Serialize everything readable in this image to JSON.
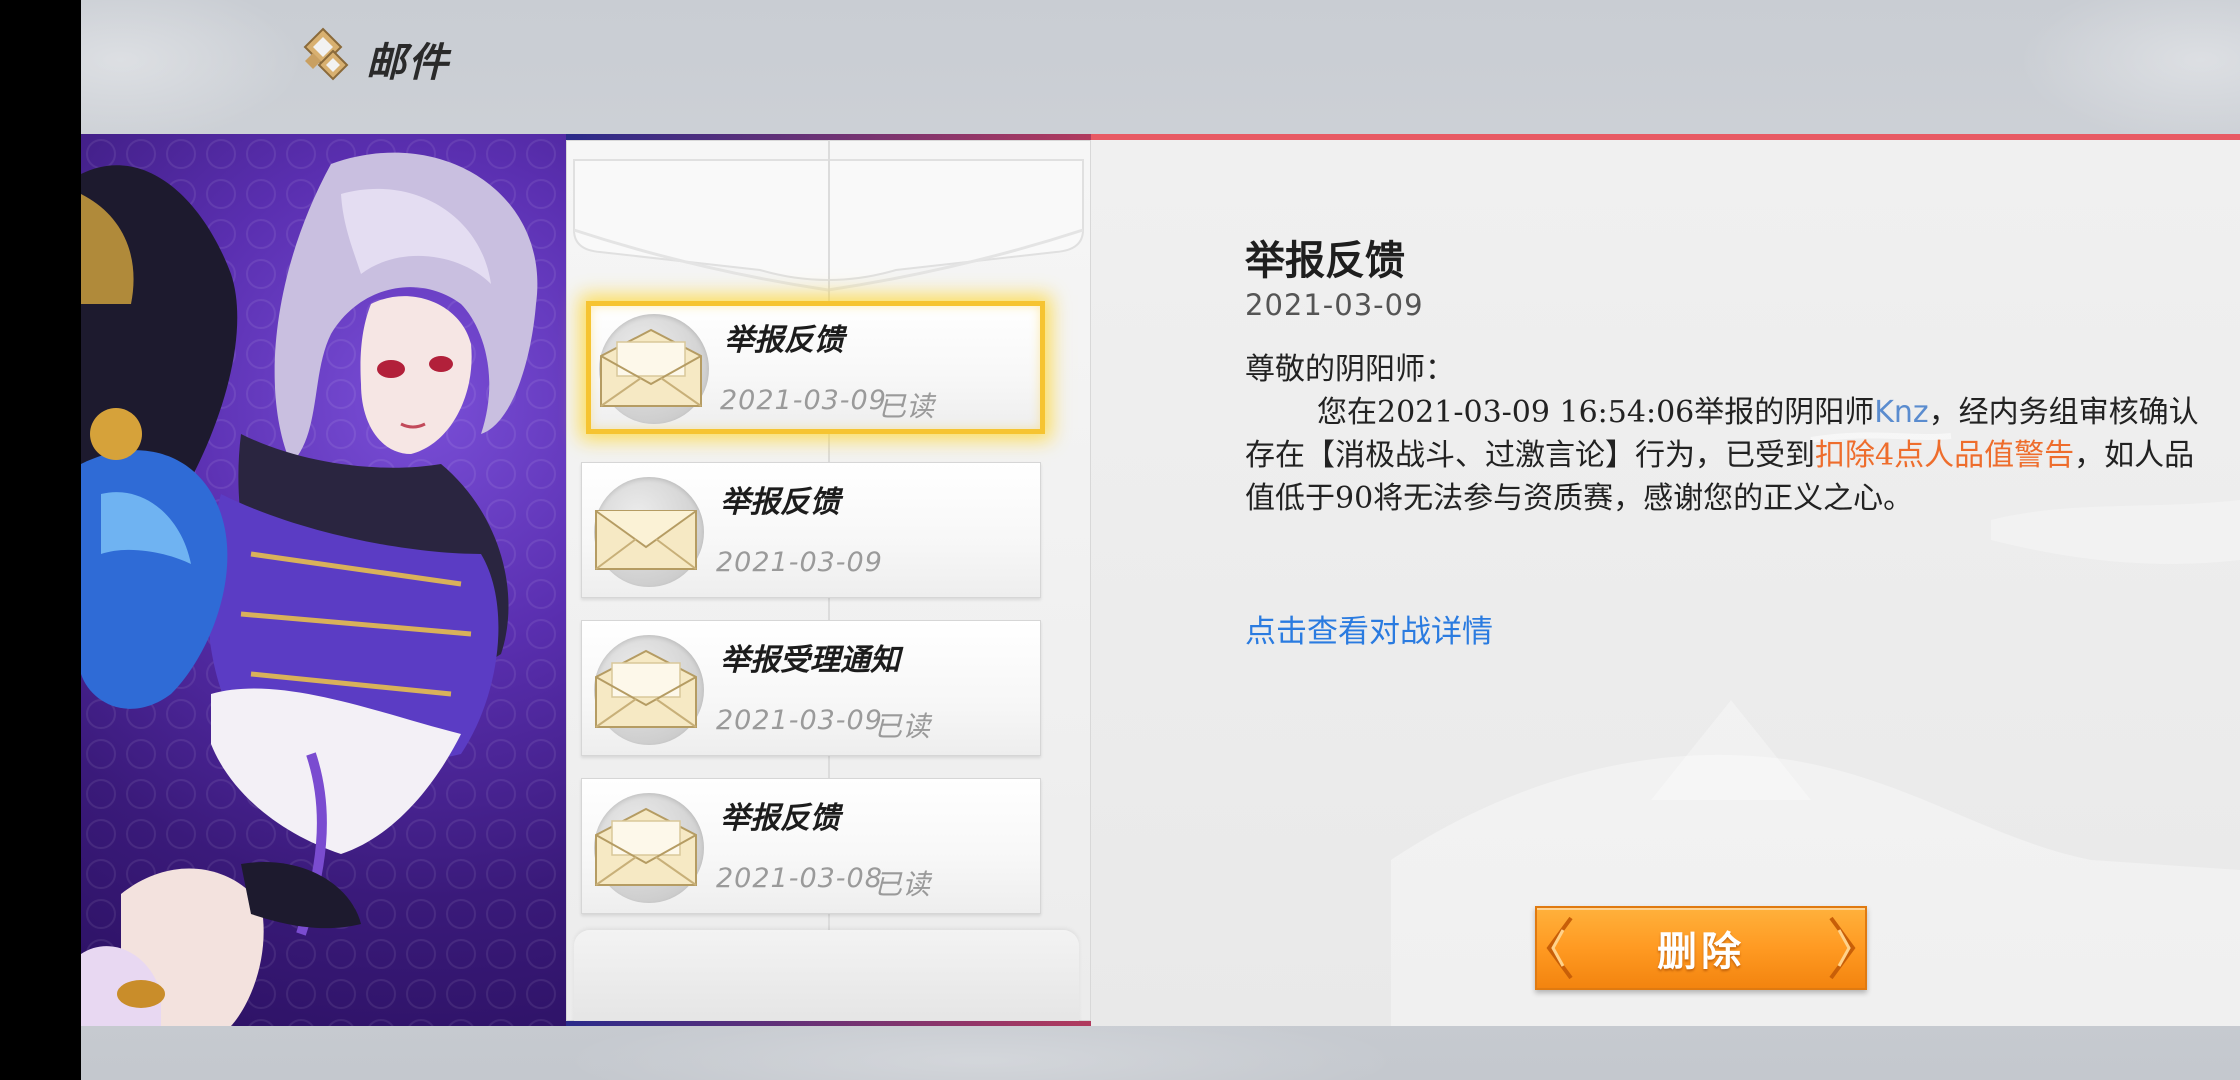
{
  "header": {
    "title": "邮件"
  },
  "mail_list": [
    {
      "title": "举报反馈",
      "date": "2021-03-09",
      "status": "已读",
      "selected": true
    },
    {
      "title": "举报反馈",
      "date": "2021-03-09",
      "status": "",
      "selected": false
    },
    {
      "title": "举报受理通知",
      "date": "2021-03-09",
      "status": "已读",
      "selected": false
    },
    {
      "title": "举报反馈",
      "date": "2021-03-08",
      "status": "已读",
      "selected": false
    }
  ],
  "detail": {
    "title": "举报反馈",
    "date": "2021-03-09",
    "greeting": "尊敬的阴阳师：",
    "body_part1": "您在2021-03-09 16:54:06举报的阴阳师",
    "player_name": "Knz",
    "body_part2": "，经内务组审核确认存在【消极战斗、过激言论】行为，已受到",
    "penalty": "扣除4点人品值警告",
    "body_part3": "，如人品值低于90将无法参与资质赛，感谢您的正义之心。",
    "link": "点击查看对战详情",
    "delete_label": "删除"
  },
  "colors": {
    "accent_red": "#e85a64",
    "highlight_gold": "#f6c431",
    "player_blue": "#5a8ccf",
    "penalty_orange": "#ee6d2c",
    "link_blue": "#2a7be0",
    "button_orange": "#ff9a22"
  },
  "icons": {
    "header_logo": "diamond-emblem-icon",
    "mail_icon": "envelope-icon"
  }
}
